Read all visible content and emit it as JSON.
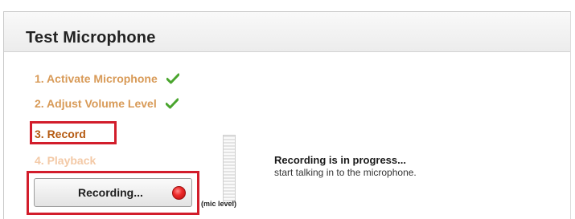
{
  "panel": {
    "title": "Test Microphone"
  },
  "steps": [
    {
      "label": "1. Activate Microphone",
      "state": "done",
      "icon": "checkmark-icon"
    },
    {
      "label": "2. Adjust Volume Level",
      "state": "done",
      "icon": "checkmark-icon"
    },
    {
      "label": "3. Record",
      "state": "current"
    },
    {
      "label": "4. Playback",
      "state": "pending"
    }
  ],
  "record_button": {
    "label": "Recording...",
    "icon": "record-dot-icon"
  },
  "mic_meter": {
    "label": "(mic level)",
    "level": 0
  },
  "status": {
    "title": "Recording is in progress...",
    "subtitle": "start talking in to the microphone."
  },
  "colors": {
    "step_done": "#d89a57",
    "step_current": "#b55a11",
    "step_pending": "#f3c9a6",
    "highlight": "#d21d2b",
    "check": "#4aa52e",
    "record_dot": "#ee2a2a"
  }
}
